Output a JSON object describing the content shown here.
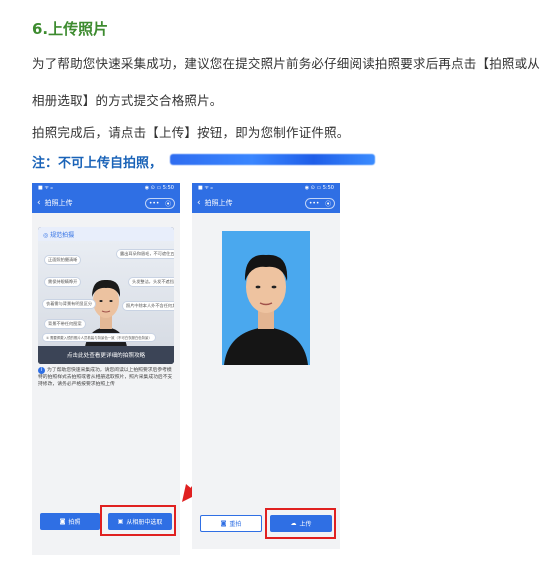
{
  "heading": "6.上传照片",
  "paragraphs": {
    "p1": "为了帮助您快速采集成功，建议您在提交照片前务必仔细阅读拍照要求后再点击【拍照或从",
    "p2": "相册选取】的方式提交合格照片。",
    "p3": "拍照完成后，请点击【上传】按钮，即为您制作证件照。"
  },
  "note": "注：不可上传自拍照，",
  "phone1": {
    "status_left": "■ ᯤ ᵢₗₗ",
    "status_right": "◉ ⊙ ▭ 5:50",
    "nav_title": "拍照上传",
    "capsule_dots": "•••",
    "capsule_icon": "⦿",
    "guide_title": "◎ 规范拍摄",
    "tips": [
      "正面照拍摄清晰",
      "露出耳朵和眉毛，不可遮住五官",
      "需保持眼睛睁开",
      "头发整洁，头发不遮挡",
      "衣着需与背景有明显区分",
      "照片中除本人外不含任何其他人物",
      "背景不带任何图案",
      "① 需要佩戴入镜的照片人员着装与背景色一致（不可白衣服白色背景）"
    ],
    "guide_footer": "点击此处查看更详细的拍照攻略",
    "description": "为了帮助您快速采集成功，请您阅读以上拍照要求后参考模特的拍照样式去拍照或者从相册选取照片，照片采集成功后不支持修改，请务必严格按要求拍照上传",
    "take_photo_label": "拍照",
    "album_label": "从相册中选取"
  },
  "phone2": {
    "status_left": "■ ᯤ ᵢₗₗ",
    "status_right": "◉ ⊙ ▭ 5:50",
    "nav_title": "拍照上传",
    "capsule_dots": "•••",
    "capsule_icon": "⦿",
    "retake_label": "重拍",
    "upload_label": "上传"
  },
  "colors": {
    "heading": "#3d8b2f",
    "note": "#1a63b8",
    "accent": "#2f6fe4",
    "highlight": "#e02020"
  }
}
